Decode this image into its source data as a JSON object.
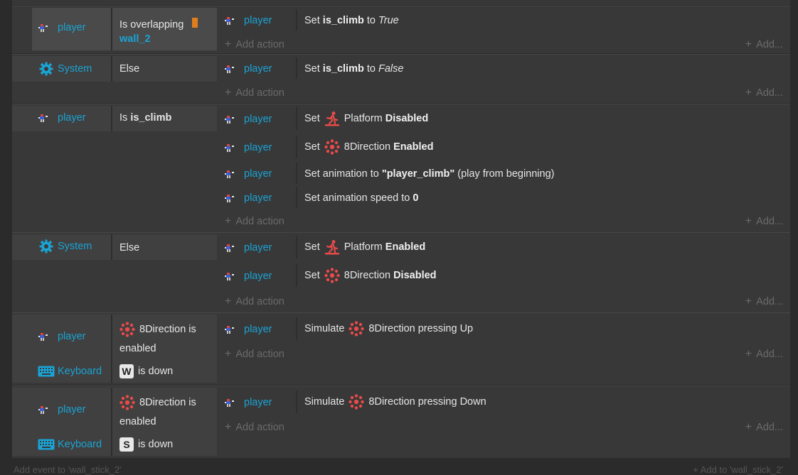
{
  "common": {
    "player": "player",
    "system": "System",
    "keyboard": "Keyboard",
    "add_action": "Add action",
    "add": "Add..."
  },
  "events": [
    {
      "conditions": [
        {
          "object": "player",
          "text_prefix": "Is overlapping",
          "text_link": "wall_2"
        }
      ],
      "actions": [
        {
          "object": "player",
          "prefix": "Set",
          "bold": "is_climb",
          "middle": "to",
          "italic": "True"
        }
      ]
    },
    {
      "conditions": [
        {
          "object": "System",
          "text": "Else"
        }
      ],
      "actions": [
        {
          "object": "player",
          "prefix": "Set",
          "bold": "is_climb",
          "middle": "to",
          "italic": "False"
        }
      ]
    },
    {
      "conditions": [
        {
          "object": "player",
          "prefix": "Is",
          "bold": "is_climb"
        }
      ],
      "actions": [
        {
          "object": "player",
          "prefix": "Set",
          "behavior": "Platform",
          "bold": "Disabled"
        },
        {
          "object": "player",
          "prefix": "Set",
          "behavior": "8Direction",
          "bold": "Enabled"
        },
        {
          "object": "player",
          "prefix": "Set animation to",
          "bold": "\"player_climb\"",
          "suffix": "(play from beginning)"
        },
        {
          "object": "player",
          "prefix": "Set animation speed to",
          "bold": "0"
        }
      ]
    },
    {
      "conditions": [
        {
          "object": "System",
          "text": "Else"
        }
      ],
      "actions": [
        {
          "object": "player",
          "prefix": "Set",
          "behavior": "Platform",
          "bold": "Enabled"
        },
        {
          "object": "player",
          "prefix": "Set",
          "behavior": "8Direction",
          "bold": "Disabled"
        }
      ]
    },
    {
      "conditions": [
        {
          "object": "player",
          "behavior": "8Direction is",
          "line2": "enabled"
        },
        {
          "object": "Keyboard",
          "key": "W",
          "text": "is down"
        }
      ],
      "actions": [
        {
          "object": "player",
          "prefix": "Simulate",
          "behavior": "8Direction pressing Up"
        }
      ]
    },
    {
      "conditions": [
        {
          "object": "player",
          "behavior": "8Direction is",
          "line2": "enabled"
        },
        {
          "object": "Keyboard",
          "key": "S",
          "text": "is down"
        }
      ],
      "actions": [
        {
          "object": "player",
          "prefix": "Simulate",
          "behavior": "8Direction pressing Down"
        }
      ]
    }
  ],
  "footer": {
    "add_event": "Add event to 'wall_stick_2'",
    "add_to": "Add to 'wall_stick_2'"
  },
  "colors": {
    "object_text": "#1aa3d4",
    "platform_icon": "#e84a4a",
    "direction_icon": "#e84a4a",
    "param_box": "#e07d1e"
  }
}
